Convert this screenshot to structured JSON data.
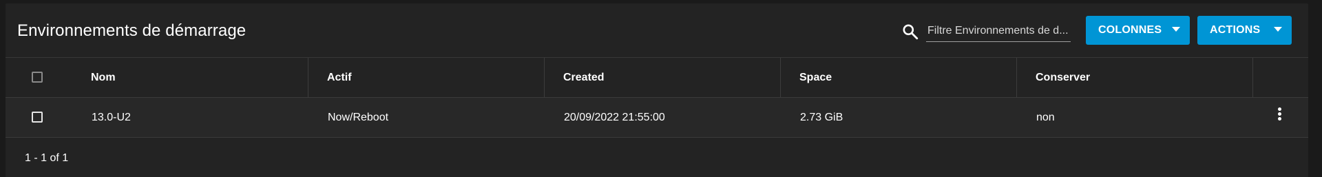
{
  "header": {
    "title": "Environnements de démarrage",
    "search_placeholder": "Filtre Environnements de d...",
    "columns_button": "COLONNES",
    "actions_button": "ACTIONS"
  },
  "table": {
    "columns": [
      "Nom",
      "Actif",
      "Created",
      "Space",
      "Conserver"
    ],
    "rows": [
      {
        "name": "13.0-U2",
        "active": "Now/Reboot",
        "created": "20/09/2022 21:55:00",
        "space": "2.73 GiB",
        "keep": "non"
      }
    ]
  },
  "pagination": {
    "range": "1 - 1 of 1"
  },
  "colors": {
    "accent": "#0095d5",
    "background": "#1a1a1a",
    "card": "#232323",
    "row": "#282828"
  },
  "icons": {
    "search": "search-icon",
    "menu": "more-vert-icon",
    "dropdown": "caret-down-icon"
  }
}
